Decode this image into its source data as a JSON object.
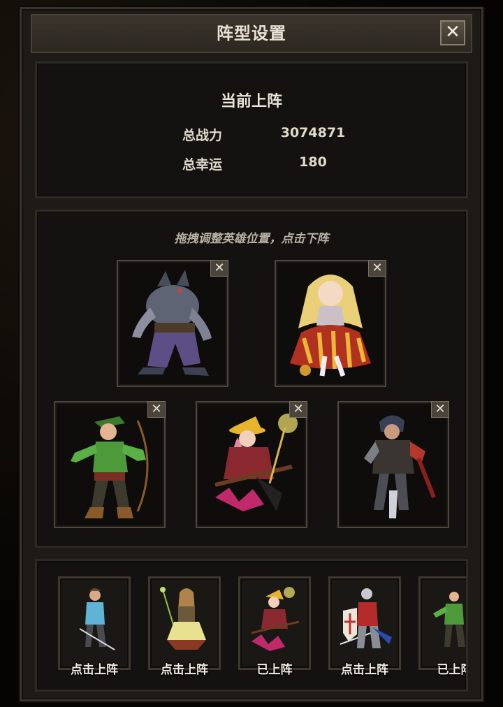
{
  "window": {
    "title": "阵型设置",
    "close_icon": "close-icon"
  },
  "lineup": {
    "heading": "当前上阵",
    "stats": [
      {
        "label": "总战力",
        "value": "3074871"
      },
      {
        "label": "总幸运",
        "value": "180"
      }
    ]
  },
  "formation": {
    "hint": "拖拽调整英雄位置，点击下阵",
    "remove_symbol": "✕",
    "slots": [
      {
        "hero": "werewolf"
      },
      {
        "hero": "golden-princess"
      },
      {
        "hero": "green-archer"
      },
      {
        "hero": "witch-on-broom"
      },
      {
        "hero": "dark-swordsman"
      }
    ]
  },
  "roster": {
    "cards": [
      {
        "hero": "blue-swordsman",
        "label": "点击上阵"
      },
      {
        "hero": "staff-mage",
        "label": "点击上阵"
      },
      {
        "hero": "witch-on-broom",
        "label": "已上阵"
      },
      {
        "hero": "shield-knight",
        "label": "点击上阵"
      },
      {
        "hero": "green-archer",
        "label": "已上阵"
      }
    ]
  },
  "colors": {
    "panel": "#1e1b17",
    "frame": "#3a342c",
    "text": "#e8e2d6"
  }
}
